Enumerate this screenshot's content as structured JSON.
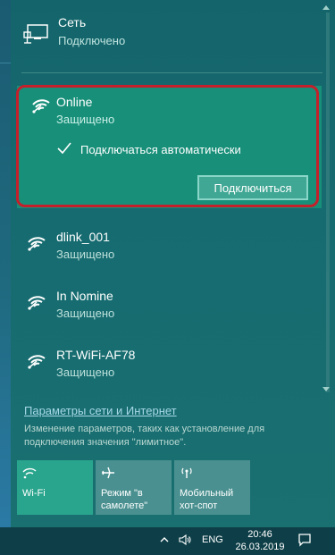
{
  "network": {
    "title": "Сеть",
    "status": "Подключено",
    "icon": "ethernet-icon"
  },
  "selected_wifi": {
    "name": "Online",
    "status": "Защищено",
    "auto_connect_label": "Подключаться автоматически",
    "auto_connect_checked": true,
    "connect_button": "Подключиться",
    "highlight_color": "#c4202b"
  },
  "wifi_list": [
    {
      "name": "dlink_001",
      "status": "Защищено"
    },
    {
      "name": "In Nomine",
      "status": "Защищено"
    },
    {
      "name": "RT-WiFi-AF78",
      "status": "Защищено"
    }
  ],
  "settings": {
    "link": "Параметры сети и Интернет",
    "description": "Изменение параметров, таких как установление для подключения значения \"лимитное\"."
  },
  "quick_actions": [
    {
      "label": "Wi-Fi",
      "icon": "wifi-icon",
      "active": true
    },
    {
      "label": "Режим \"в самолете\"",
      "icon": "airplane-icon",
      "active": false
    },
    {
      "label": "Мобильный хот-спот",
      "icon": "hotspot-icon",
      "active": false
    }
  ],
  "taskbar": {
    "language": "ENG",
    "time": "20:46",
    "date": "26.03.2019"
  },
  "colors": {
    "panel": "#166b70",
    "selected": "#178f79",
    "tile_active": "#2aa58d",
    "tile_inactive": "#4a9090",
    "taskbar": "#0e3f48"
  }
}
